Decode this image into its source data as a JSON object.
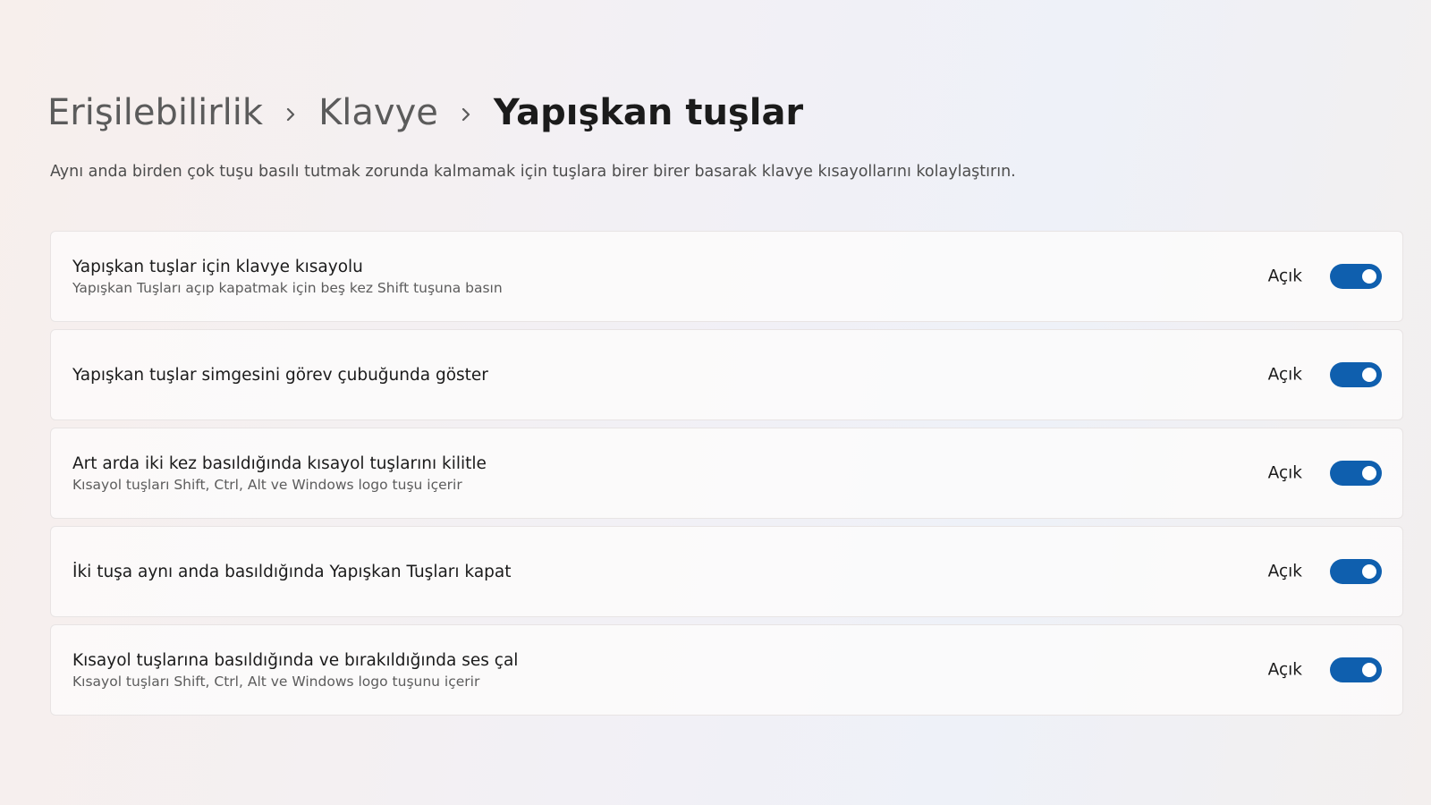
{
  "breadcrumb": {
    "items": [
      "Erişilebilirlik",
      "Klavye"
    ],
    "current": "Yapışkan tuşlar"
  },
  "description": "Aynı anda birden çok tuşu basılı tutmak zorunda kalmamak için tuşlara birer birer basarak klavye kısayollarını kolaylaştırın.",
  "settings": [
    {
      "title": "Yapışkan tuşlar için klavye kısayolu",
      "subtitle": "Yapışkan Tuşları açıp kapatmak için beş kez Shift tuşuna basın",
      "state_label": "Açık",
      "on": true
    },
    {
      "title": "Yapışkan tuşlar simgesini görev çubuğunda göster",
      "subtitle": "",
      "state_label": "Açık",
      "on": true
    },
    {
      "title": "Art arda iki kez basıldığında kısayol tuşlarını kilitle",
      "subtitle": "Kısayol tuşları Shift, Ctrl, Alt ve Windows logo tuşu içerir",
      "state_label": "Açık",
      "on": true
    },
    {
      "title": "İki tuşa aynı anda basıldığında Yapışkan Tuşları kapat",
      "subtitle": "",
      "state_label": "Açık",
      "on": true
    },
    {
      "title": "Kısayol tuşlarına basıldığında ve bırakıldığında ses çal",
      "subtitle": "Kısayol tuşları Shift, Ctrl, Alt ve Windows logo tuşunu içerir",
      "state_label": "Açık",
      "on": true
    }
  ],
  "colors": {
    "toggle_on": "#0f5fae",
    "knob": "#ffffff"
  },
  "icons": {
    "breadcrumb_separator": "chevron-right-icon"
  }
}
